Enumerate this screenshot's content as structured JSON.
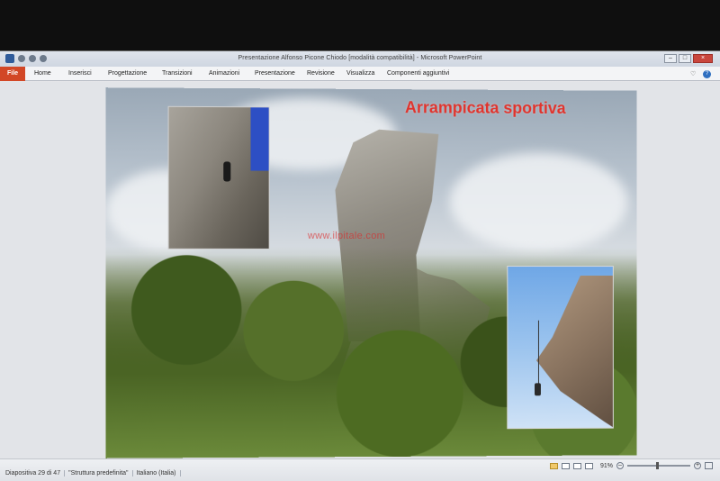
{
  "window": {
    "title": "Presentazione Alfonso Picone Chiodo [modalità compatibilità] - Microsoft PowerPoint"
  },
  "ribbon": {
    "file_tab": "File",
    "tabs": [
      "Home",
      "Inserisci",
      "Progettazione",
      "Transizioni",
      "Animazioni",
      "Presentazione",
      "Revisione",
      "Visualizza",
      "Componenti aggiuntivi"
    ]
  },
  "slide": {
    "title": "Arrampicata sportiva",
    "watermark": "www.ilpitale.com"
  },
  "statusbar": {
    "slide_counter": "Diapositiva 29 di 47",
    "theme": "\"Struttura predefinita\"",
    "language": "Italiano (Italia)",
    "zoom": "91%"
  },
  "colors": {
    "file_tab": "#d24726",
    "slide_title": "#e0332c"
  }
}
